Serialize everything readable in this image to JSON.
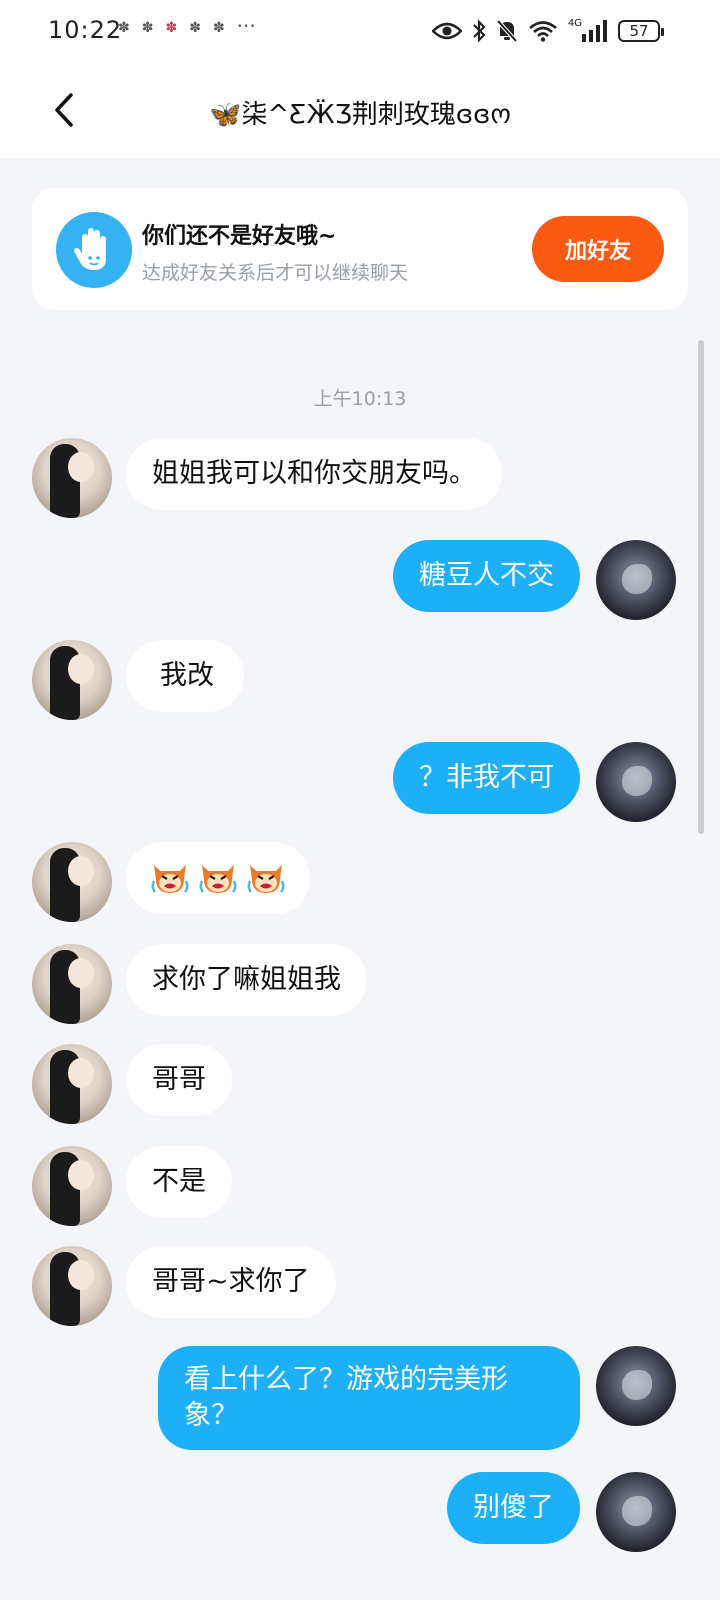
{
  "status_bar": {
    "time": "10:22",
    "notification_icons": [
      "notif-icon",
      "notif-icon",
      "notif-icon",
      "notif-icon",
      "notif-icon"
    ],
    "more": "···",
    "network": "4G",
    "battery": "57"
  },
  "header": {
    "title": "🦋柒^ƸӜƷ荆刺玫瑰ɞɞო"
  },
  "banner": {
    "title": "你们还不是好友哦~",
    "subtitle": "达成好友关系后才可以继续聊天",
    "button_label": "加好友",
    "accent_color": "#fa5a12",
    "icon_color": "#34b2f2"
  },
  "timestamp": "上午10:13",
  "messages": [
    {
      "side": "in",
      "text": "姐姐我可以和你交朋友吗。"
    },
    {
      "side": "out",
      "text": "糖豆人不交"
    },
    {
      "side": "in",
      "text": "我改"
    },
    {
      "side": "out",
      "text": "？非我不可"
    },
    {
      "side": "in",
      "text": "",
      "emoji": [
        "crying-face-icon",
        "crying-face-icon",
        "crying-face-icon"
      ]
    },
    {
      "side": "in",
      "text": "求你了嘛姐姐我"
    },
    {
      "side": "in",
      "text": "哥哥"
    },
    {
      "side": "in",
      "text": "不是"
    },
    {
      "side": "in",
      "text": "哥哥~求你了"
    },
    {
      "side": "out",
      "text": "看上什么了？游戏的完美形象？"
    },
    {
      "side": "out",
      "text": "别傻了"
    }
  ],
  "colors": {
    "bubble_out": "#1eb0f6",
    "bubble_in": "#ffffff",
    "background": "#f3f5f8"
  }
}
